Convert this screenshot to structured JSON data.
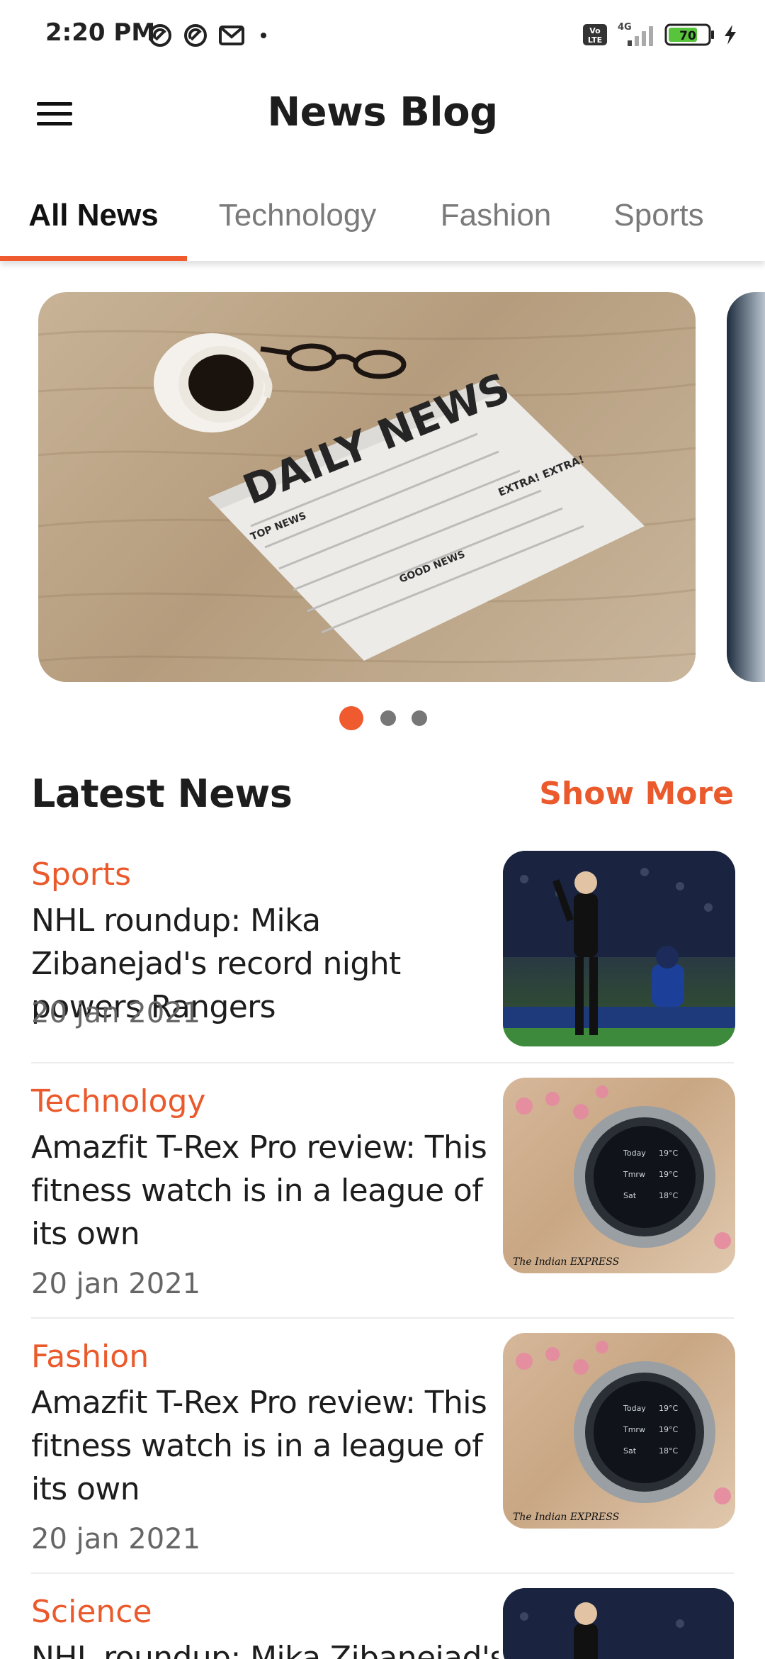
{
  "status_bar": {
    "time": "2:20 PM",
    "network": "4G",
    "volte": "Vo LTE",
    "battery": "70",
    "left_icons": [
      "signal-ring-icon",
      "signal-ring-icon",
      "gmail-icon",
      "dot-icon"
    ],
    "right_icons": [
      "volte-icon",
      "cellular-signal-icon",
      "battery-icon",
      "charging-bolt-icon"
    ]
  },
  "app_bar": {
    "title": "News Blog",
    "menu_icon": "hamburger-menu-icon"
  },
  "tabs": [
    {
      "label": "All News",
      "active": true
    },
    {
      "label": "Technology",
      "active": false
    },
    {
      "label": "Fashion",
      "active": false
    },
    {
      "label": "Sports",
      "active": false
    }
  ],
  "carousel": {
    "slides": [
      {
        "image": "daily-news-newspaper-with-coffee-and-glasses",
        "text": {
          "headline": "DAILY NEWS",
          "top": "TOP NEWS",
          "extra": "EXTRA! EXTRA!",
          "good": "GOOD NEWS"
        }
      },
      {
        "image": "partial-next-slide"
      }
    ],
    "dot_count": 3,
    "active_index": 0
  },
  "latest_news": {
    "title": "Latest News",
    "show_more": "Show More",
    "items": [
      {
        "category": "Sports",
        "headline": "NHL roundup: Mika Zibanejad's record night powers Rangers",
        "date": "20 jan 2021",
        "thumbnail": "cricket-player-celebrating"
      },
      {
        "category": "Technology",
        "headline": "Amazfit T-Rex Pro review: This fitness watch is in a league of its own",
        "date": "20 jan 2021",
        "thumbnail": "smartwatch-on-sand",
        "watermark": "The Indian EXPRESS"
      },
      {
        "category": "Fashion",
        "headline": "Amazfit T-Rex Pro review: This fitness watch is in a league of its own",
        "date": "20 jan 2021",
        "thumbnail": "smartwatch-on-sand",
        "watermark": "The Indian EXPRESS"
      },
      {
        "category": "Science",
        "headline": "NHL roundup: Mika Zibanejad's",
        "date": "",
        "thumbnail": "cricket-player-celebrating"
      }
    ]
  },
  "colors": {
    "accent": "#f05a2f",
    "text_primary": "#1d1d1d",
    "text_secondary": "#7a7a7a",
    "background": "#ffffff"
  }
}
